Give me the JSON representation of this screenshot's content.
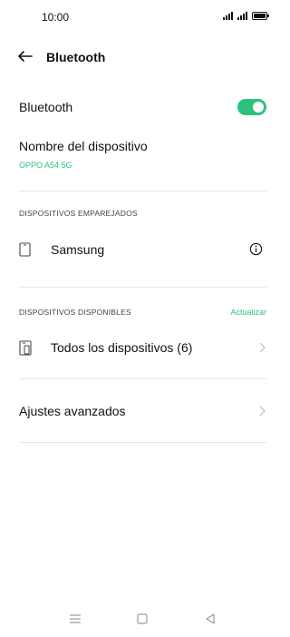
{
  "status_bar": {
    "time": "10:00"
  },
  "header": {
    "title": "Bluetooth"
  },
  "bluetooth": {
    "label": "Bluetooth",
    "enabled": true
  },
  "device_name": {
    "label": "Nombre del dispositivo",
    "value": "OPPO A54 5G"
  },
  "paired": {
    "section_title": "DISPOSITIVOS EMPAREJADOS",
    "devices": [
      {
        "name": "Samsung",
        "icon": "phone-icon"
      }
    ]
  },
  "available": {
    "section_title": "DISPOSITIVOS DISPONIBLES",
    "refresh_label": "Actualizar",
    "all_devices_label": "Todos los dispositivos (6)"
  },
  "advanced": {
    "label": "Ajustes avanzados"
  },
  "colors": {
    "accent": "#2bc37c",
    "divider": "#e6e6e6",
    "text": "#111111"
  }
}
